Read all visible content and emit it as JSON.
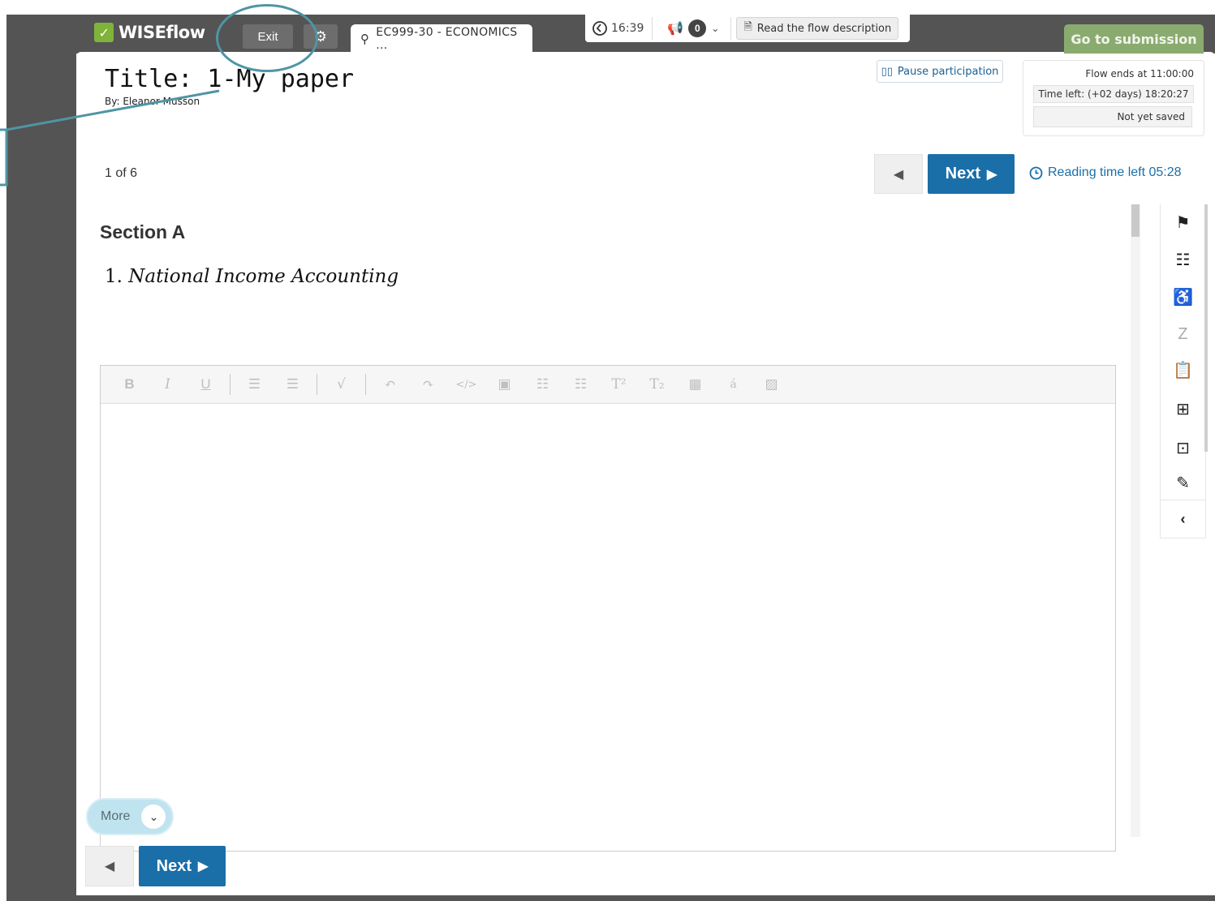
{
  "topbar": {
    "brand": "WISEflow",
    "exit_label": "Exit",
    "flow_tab_label": "EC999-30 - ECONOMICS ...",
    "clock_time": "16:39",
    "notification_count": "0",
    "read_flow_label": "Read the flow description",
    "go_to_submission_label": "Go to submission"
  },
  "header": {
    "title": "Title: 1-My paper",
    "author": "By: Eleanor Musson",
    "pause_label": "Pause participation",
    "flow_ends": "Flow ends at 11:00:00",
    "time_left": "Time left: (+02 days) 18:20:27",
    "save_status": "Not yet saved"
  },
  "pager": {
    "counter": "1 of 6",
    "next_label": "Next",
    "reading_time": "Reading time left 05:28"
  },
  "content": {
    "section_heading": "Section A",
    "question_number": "1.",
    "question_title": "National Income Accounting"
  },
  "editor": {
    "toolbar": [
      "bold",
      "italic",
      "underline",
      "indent",
      "outdent",
      "math",
      "undo",
      "redo",
      "code",
      "embed",
      "bullet-list",
      "numbered-list",
      "superscript",
      "subscript",
      "table",
      "special-character",
      "image"
    ]
  },
  "footer": {
    "more_label": "More",
    "next_label": "Next"
  },
  "tool_rail": {
    "tools": [
      "flag",
      "checklist",
      "accessibility",
      "translate",
      "clipboard",
      "add-note",
      "search-note",
      "pen"
    ]
  },
  "colors": {
    "primary": "#1a6fa8",
    "frame": "#545454",
    "submission": "#8aab6f",
    "annotation": "#4f95a4"
  }
}
